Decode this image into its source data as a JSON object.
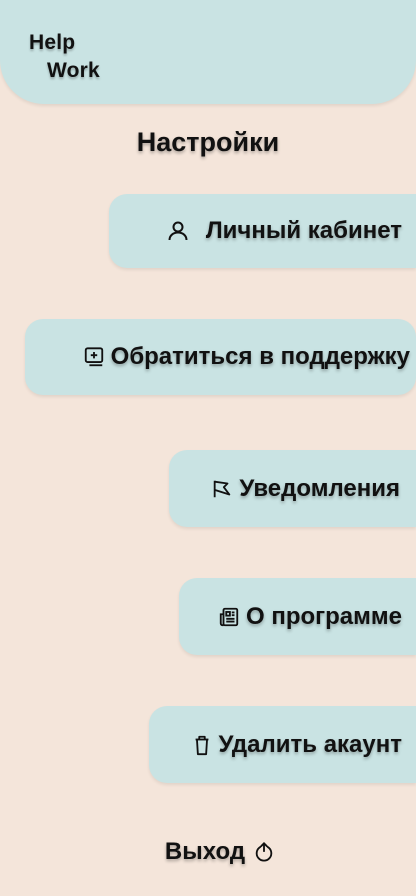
{
  "logo": {
    "line1": "Help",
    "line2": "Work"
  },
  "title": "Настройки",
  "menu": {
    "account": {
      "label": "Личный кабинет",
      "icon": "user-icon"
    },
    "support": {
      "label": "Обратиться в поддержку",
      "icon": "add-message-icon"
    },
    "notifications": {
      "label": "Уведомления",
      "icon": "megaphone-icon"
    },
    "about": {
      "label": "О программе",
      "icon": "newspaper-icon"
    },
    "delete": {
      "label": "Удалить акаунт",
      "icon": "trash-icon"
    }
  },
  "logout": {
    "label": "Выход",
    "icon": "power-icon"
  },
  "colors": {
    "background": "#f4e5da",
    "card": "#c9e3e3",
    "text": "#111111"
  }
}
